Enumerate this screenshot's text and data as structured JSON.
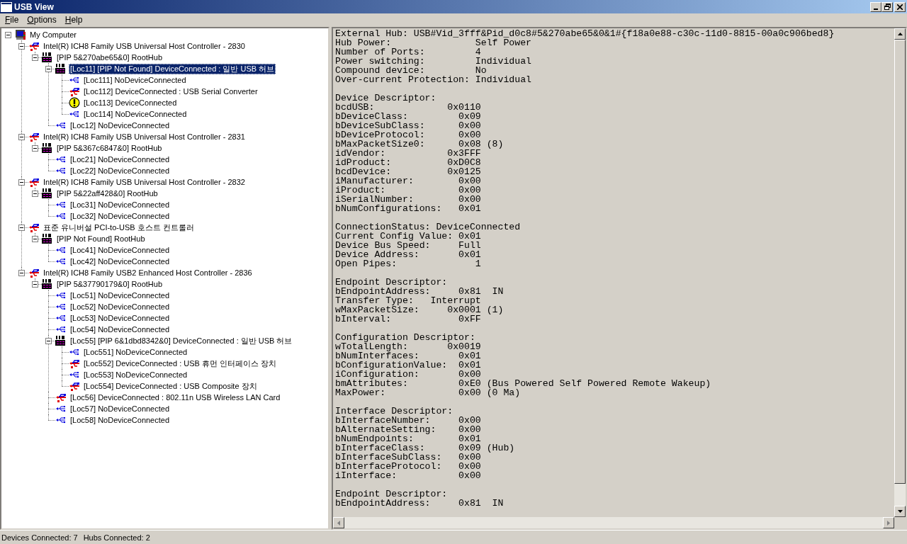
{
  "window": {
    "title": "USB View"
  },
  "menu": [
    {
      "label": "File"
    },
    {
      "label": "Options"
    },
    {
      "label": "Help"
    }
  ],
  "tree": [
    {
      "label": "My Computer",
      "kind": "computer",
      "selected": false,
      "expanded": true,
      "children": [
        {
          "label": "Intel(R) ICH8 Family USB Universal Host Controller - 2830",
          "kind": "controller",
          "selected": false,
          "expanded": true,
          "children": [
            {
              "label": "[PIP 5&270abe65&0] RootHub",
              "kind": "hub",
              "selected": false,
              "expanded": true,
              "children": [
                {
                  "label": "[Loc11] [PIP Not Found] DeviceConnected :  일반 USB 허브",
                  "kind": "hub",
                  "selected": true,
                  "expanded": true,
                  "children": [
                    {
                      "label": "[Loc111] NoDeviceConnected",
                      "kind": "port",
                      "selected": false
                    },
                    {
                      "label": "[Loc112] DeviceConnected :  USB Serial Converter",
                      "kind": "device",
                      "selected": false
                    },
                    {
                      "label": "[Loc113] DeviceConnected",
                      "kind": "warning",
                      "selected": false
                    },
                    {
                      "label": "[Loc114] NoDeviceConnected",
                      "kind": "port",
                      "selected": false
                    }
                  ]
                },
                {
                  "label": "[Loc12] NoDeviceConnected",
                  "kind": "port",
                  "selected": false
                }
              ]
            }
          ]
        },
        {
          "label": "Intel(R) ICH8 Family USB Universal Host Controller - 2831",
          "kind": "controller",
          "selected": false,
          "expanded": true,
          "children": [
            {
              "label": "[PIP 5&367c6847&0] RootHub",
              "kind": "hub",
              "selected": false,
              "expanded": true,
              "children": [
                {
                  "label": "[Loc21] NoDeviceConnected",
                  "kind": "port",
                  "selected": false
                },
                {
                  "label": "[Loc22] NoDeviceConnected",
                  "kind": "port",
                  "selected": false
                }
              ]
            }
          ]
        },
        {
          "label": "Intel(R) ICH8 Family USB Universal Host Controller - 2832",
          "kind": "controller",
          "selected": false,
          "expanded": true,
          "children": [
            {
              "label": "[PIP 5&22aff428&0] RootHub",
              "kind": "hub",
              "selected": false,
              "expanded": true,
              "children": [
                {
                  "label": "[Loc31] NoDeviceConnected",
                  "kind": "port",
                  "selected": false
                },
                {
                  "label": "[Loc32] NoDeviceConnected",
                  "kind": "port",
                  "selected": false
                }
              ]
            }
          ]
        },
        {
          "label": "표준 유니버설 PCI-to-USB 호스트 컨트롤러",
          "kind": "controller",
          "selected": false,
          "expanded": true,
          "children": [
            {
              "label": "[PIP Not Found] RootHub",
              "kind": "hub",
              "selected": false,
              "expanded": true,
              "children": [
                {
                  "label": "[Loc41] NoDeviceConnected",
                  "kind": "port",
                  "selected": false
                },
                {
                  "label": "[Loc42] NoDeviceConnected",
                  "kind": "port",
                  "selected": false
                }
              ]
            }
          ]
        },
        {
          "label": "Intel(R) ICH8 Family USB2 Enhanced Host Controller - 2836",
          "kind": "controller",
          "selected": false,
          "expanded": true,
          "children": [
            {
              "label": "[PIP 5&37790179&0] RootHub",
              "kind": "hub",
              "selected": false,
              "expanded": true,
              "children": [
                {
                  "label": "[Loc51] NoDeviceConnected",
                  "kind": "port",
                  "selected": false
                },
                {
                  "label": "[Loc52] NoDeviceConnected",
                  "kind": "port",
                  "selected": false
                },
                {
                  "label": "[Loc53] NoDeviceConnected",
                  "kind": "port",
                  "selected": false
                },
                {
                  "label": "[Loc54] NoDeviceConnected",
                  "kind": "port",
                  "selected": false
                },
                {
                  "label": "[Loc55] [PIP 6&1dbd8342&0] DeviceConnected :  일반 USB 허브",
                  "kind": "hub",
                  "selected": false,
                  "expanded": true,
                  "children": [
                    {
                      "label": "[Loc551] NoDeviceConnected",
                      "kind": "port",
                      "selected": false
                    },
                    {
                      "label": "[Loc552] DeviceConnected :  USB 휴먼 인터페이스 장치",
                      "kind": "device",
                      "selected": false
                    },
                    {
                      "label": "[Loc553] NoDeviceConnected",
                      "kind": "port",
                      "selected": false
                    },
                    {
                      "label": "[Loc554] DeviceConnected :  USB Composite 장치",
                      "kind": "device",
                      "selected": false
                    }
                  ]
                },
                {
                  "label": "[Loc56] DeviceConnected :  802.11n USB Wireless LAN Card",
                  "kind": "device",
                  "selected": false
                },
                {
                  "label": "[Loc57] NoDeviceConnected",
                  "kind": "port",
                  "selected": false
                },
                {
                  "label": "[Loc58] NoDeviceConnected",
                  "kind": "port",
                  "selected": false
                }
              ]
            }
          ]
        }
      ]
    }
  ],
  "details": [
    [
      "External Hub: USB#Vid_3fff&Pid_d0c8#5&270abe65&0&1#{f18a0e88-c30c-11d0-8815-00a0c906bed8}",
      "Hub Power:               Self Power",
      "Number of Ports:         4",
      "Power switching:         Individual",
      "Compound device:         No",
      "Over-current Protection: Individual"
    ],
    [
      "Device Descriptor:",
      "bcdUSB:             0x0110",
      "bDeviceClass:         0x09",
      "bDeviceSubClass:      0x00",
      "bDeviceProtocol:      0x00",
      "bMaxPacketSize0:      0x08 (8)",
      "idVendor:           0x3FFF",
      "idProduct:          0xD0C8",
      "bcdDevice:          0x0125",
      "iManufacturer:        0x00",
      "iProduct:             0x00",
      "iSerialNumber:        0x00",
      "bNumConfigurations:   0x01"
    ],
    [
      "ConnectionStatus: DeviceConnected",
      "Current Config Value: 0x01",
      "Device Bus Speed:     Full",
      "Device Address:       0x01",
      "Open Pipes:              1"
    ],
    [
      "Endpoint Descriptor:",
      "bEndpointAddress:     0x81  IN",
      "Transfer Type:   Interrupt",
      "wMaxPacketSize:     0x0001 (1)",
      "bInterval:            0xFF"
    ],
    [
      "Configuration Descriptor:",
      "wTotalLength:       0x0019",
      "bNumInterfaces:       0x01",
      "bConfigurationValue:  0x01",
      "iConfiguration:       0x00",
      "bmAttributes:         0xE0 (Bus Powered Self Powered Remote Wakeup)",
      "MaxPower:             0x00 (0 Ma)"
    ],
    [
      "Interface Descriptor:",
      "bInterfaceNumber:     0x00",
      "bAlternateSetting:    0x00",
      "bNumEndpoints:        0x01",
      "bInterfaceClass:      0x09 (Hub)",
      "bInterfaceSubClass:   0x00",
      "bInterfaceProtocol:   0x00",
      "iInterface:           0x00"
    ],
    [
      "Endpoint Descriptor:",
      "bEndpointAddress:     0x81  IN"
    ]
  ],
  "status_bar": [
    {
      "text": "Devices Connected: 7"
    },
    {
      "text": "Hubs Connected: 2"
    }
  ]
}
